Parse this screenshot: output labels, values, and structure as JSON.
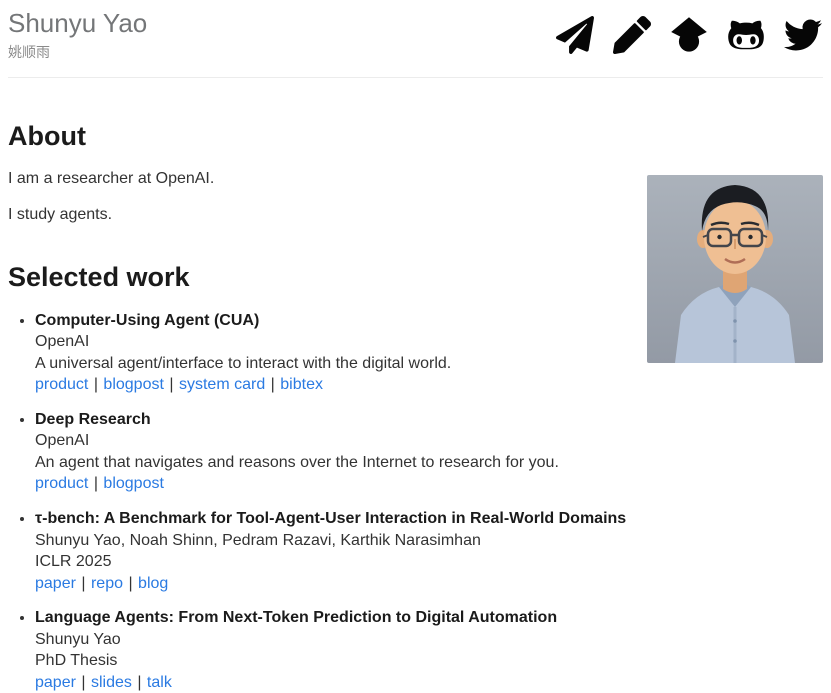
{
  "header": {
    "name": "Shunyu Yao",
    "name_cn": "姚顺雨",
    "icons": [
      {
        "name": "paper-plane-icon",
        "label": "email"
      },
      {
        "name": "pencil-icon",
        "label": "blog"
      },
      {
        "name": "graduation-cap-icon",
        "label": "google-scholar"
      },
      {
        "name": "github-icon",
        "label": "github"
      },
      {
        "name": "twitter-icon",
        "label": "twitter"
      }
    ]
  },
  "about": {
    "title": "About",
    "paragraphs": [
      "I am a researcher at OpenAI.",
      "I study agents."
    ]
  },
  "work": {
    "title": "Selected work",
    "link_separator": " | ",
    "items": [
      {
        "title": "Computer-Using Agent (CUA)",
        "lines": [
          "OpenAI",
          "A universal agent/interface to interact with the digital world."
        ],
        "links": [
          "product",
          "blogpost",
          "system card",
          "bibtex"
        ]
      },
      {
        "title": "Deep Research",
        "lines": [
          "OpenAI",
          "An agent that navigates and reasons over the Internet to research for you."
        ],
        "links": [
          "product",
          "blogpost"
        ]
      },
      {
        "title": "τ-bench: A Benchmark for Tool-Agent-User Interaction in Real-World Domains",
        "lines": [
          "Shunyu Yao, Noah Shinn, Pedram Razavi, Karthik Narasimhan",
          "ICLR 2025"
        ],
        "links": [
          "paper",
          "repo",
          "blog"
        ]
      },
      {
        "title": "Language Agents: From Next-Token Prediction to Digital Automation",
        "lines": [
          "Shunyu Yao",
          "PhD Thesis"
        ],
        "links": [
          "paper",
          "slides",
          "talk"
        ]
      }
    ]
  },
  "colors": {
    "link": "#2a7ae2",
    "heading": "#1b1b1b",
    "icon": "#060606"
  }
}
